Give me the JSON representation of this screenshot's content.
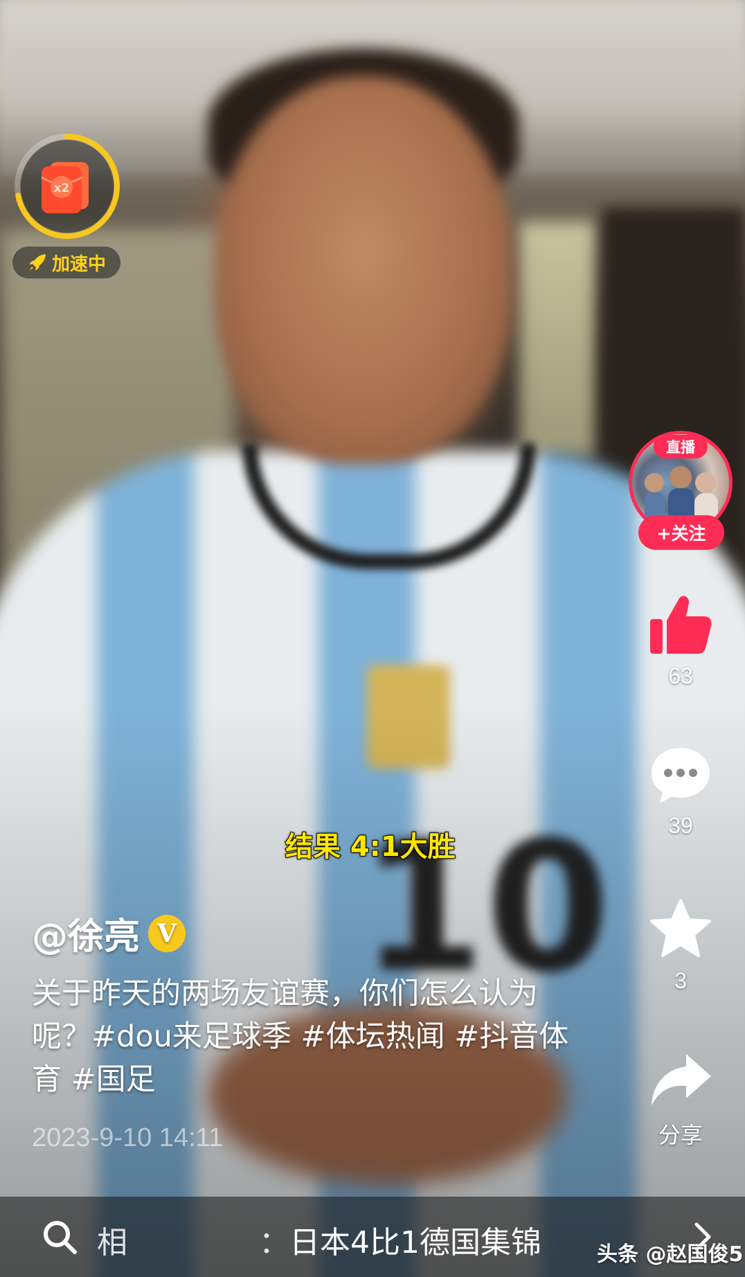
{
  "reward": {
    "multiplier": "x2",
    "boost_label": "加速中",
    "progress": 0.72,
    "ring_color": "#f7c81e",
    "envelope_color": "#ff4a2e"
  },
  "rail": {
    "live_label": "直播",
    "follow_label": "+关注",
    "like_count": "63",
    "comment_count": "39",
    "favorite_count": "3",
    "share_label": "分享",
    "accent_color": "#ff2c55",
    "like_color": "#ff2c55"
  },
  "video": {
    "subtitle": "结果 4:1大胜"
  },
  "caption": {
    "author": "@徐亮",
    "verified_mark": "V",
    "description": "关于昨天的两场友谊赛，你们怎么认为呢？#dou来足球季 #体坛热闻 #抖音体育 #国足",
    "timestamp": "2023-9-10 14:11"
  },
  "related": {
    "prefix": "相",
    "separator": "：",
    "text": "日本4比1德国集锦"
  },
  "watermark": "头条 @赵国俊5",
  "icons": [
    "rocket-icon",
    "red-envelope-icon",
    "like-icon",
    "comment-icon",
    "star-icon",
    "share-icon",
    "search-icon",
    "chevron-right-icon"
  ]
}
